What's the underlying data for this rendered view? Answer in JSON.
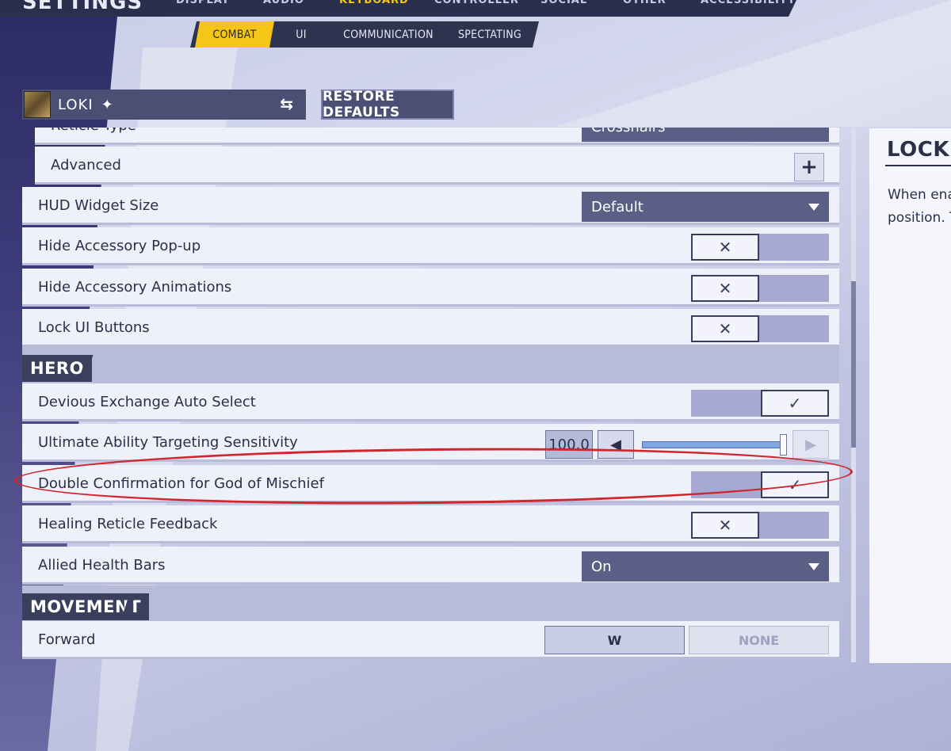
{
  "header": {
    "title": "SETTINGS",
    "main_tabs": [
      "DISPLAY",
      "AUDIO",
      "KEYBOARD",
      "CONTROLLER",
      "SOCIAL",
      "OTHER",
      "ACCESSIBILITY"
    ],
    "active_main_tab": "KEYBOARD"
  },
  "sub_tabs": [
    "COMBAT",
    "UI",
    "COMMUNICATION",
    "SPECTATING"
  ],
  "hero": {
    "name": "LOKI",
    "star_icon": "diamond-star-icon",
    "swap_icon": "swap-arrows-icon"
  },
  "restore_defaults_label": "RESTORE DEFAULTS",
  "rows": {
    "reticle_type": {
      "label": "Reticle Type",
      "value": "Crosshairs"
    },
    "advanced": {
      "label": "Advanced",
      "button": "+"
    },
    "hud_widget_size": {
      "label": "HUD Widget Size",
      "value": "Default"
    },
    "hide_accessory_popup": {
      "label": "Hide Accessory Pop-up",
      "state": "off",
      "glyph": "✕"
    },
    "hide_accessory_animations": {
      "label": "Hide Accessory Animations",
      "state": "off",
      "glyph": "✕"
    },
    "lock_ui_buttons": {
      "label": "Lock UI Buttons",
      "state": "off",
      "glyph": "✕"
    },
    "devious_exchange": {
      "label": "Devious Exchange Auto Select",
      "state": "on",
      "glyph": "✓"
    },
    "ultimate_sensitivity": {
      "label": "Ultimate Ability Targeting Sensitivity",
      "value": "100.0",
      "dec": "◀",
      "inc": "▶",
      "level_percent": 100
    },
    "double_confirmation": {
      "label": "Double Confirmation for God of Mischief",
      "state": "on",
      "glyph": "✓"
    },
    "healing_reticle": {
      "label": "Healing Reticle Feedback",
      "state": "off",
      "glyph": "✕"
    },
    "allied_health_bars": {
      "label": "Allied Health Bars",
      "value": "On"
    },
    "forward": {
      "label": "Forward",
      "primary_key": "W",
      "secondary_key": "NONE"
    }
  },
  "sections": {
    "hero": "HERO",
    "movement": "MOVEMENT"
  },
  "description": {
    "title": "LOCK UI BUTTONS",
    "text": "When enabled, UI buttons will not change position. This notification"
  },
  "colors": {
    "accent": "#f5c518",
    "annotation": "#d0262c",
    "panel": "#eef0fa"
  }
}
